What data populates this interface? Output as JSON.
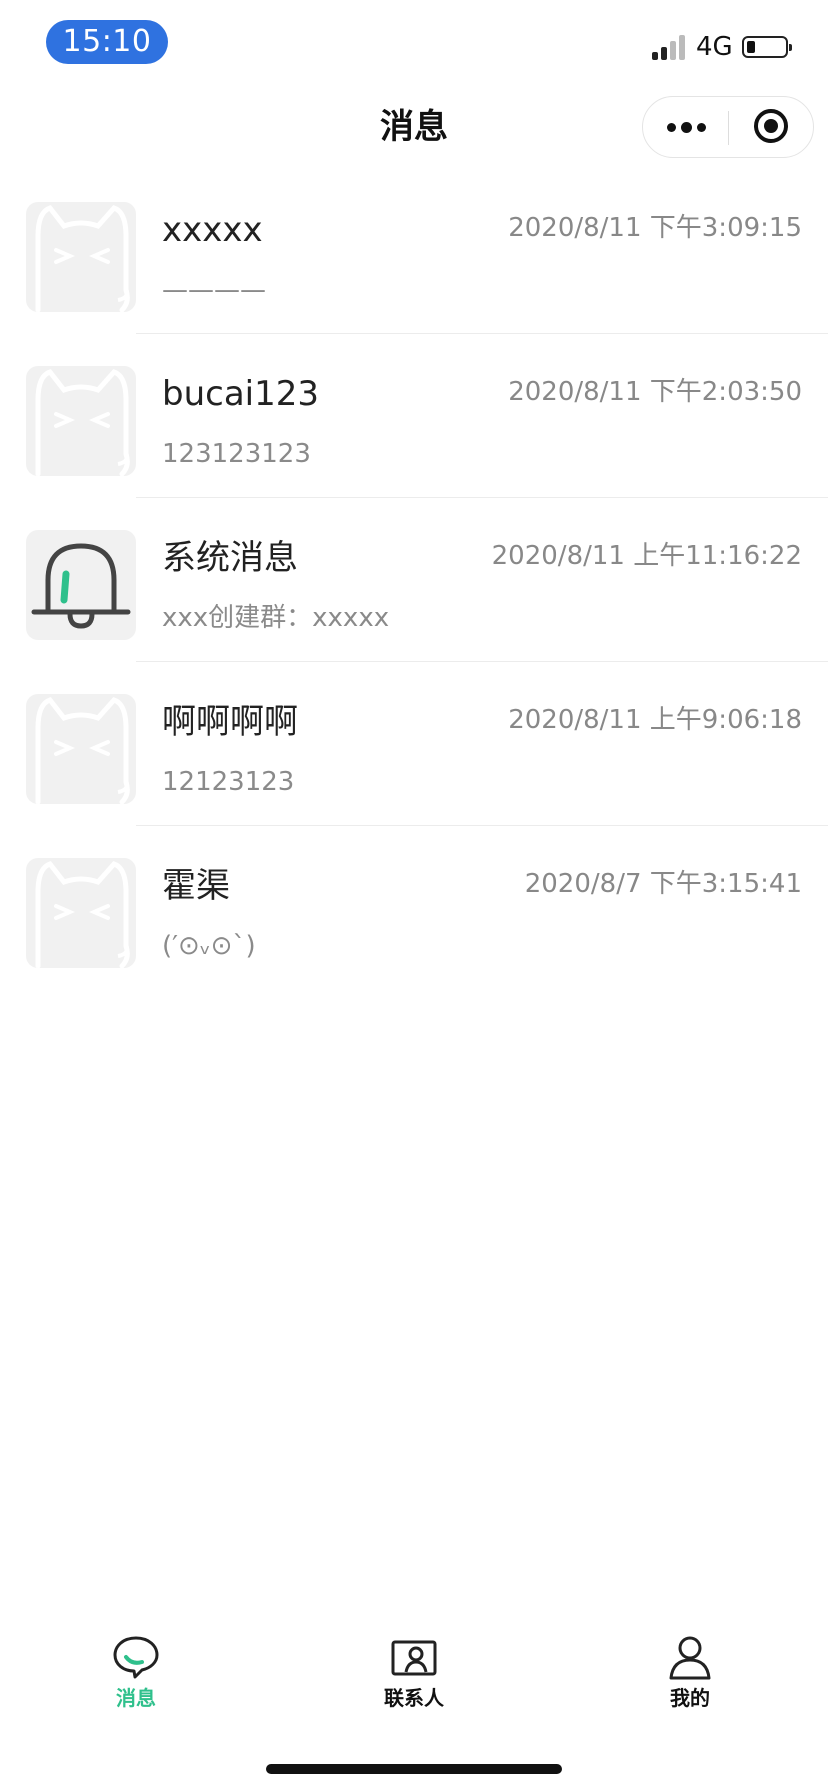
{
  "status_bar": {
    "time": "15:10",
    "network": "4G"
  },
  "nav": {
    "title": "消息"
  },
  "messages": [
    {
      "name": "xxxxx",
      "time": "2020/8/11 下午3:09:15",
      "preview": "————",
      "avatar": "cat-avatar-icon"
    },
    {
      "name": "bucai123",
      "time": "2020/8/11 下午2:03:50",
      "preview": "123123123",
      "avatar": "cat-avatar-icon"
    },
    {
      "name": "系统消息",
      "time": "2020/8/11 上午11:16:22",
      "preview": "xxx创建群：xxxxx",
      "avatar": "bell-icon"
    },
    {
      "name": "啊啊啊啊",
      "time": "2020/8/11 上午9:06:18",
      "preview": "12123123",
      "avatar": "cat-avatar-icon"
    },
    {
      "name": "霍渠",
      "time": "2020/8/7 下午3:15:41",
      "preview": "(′⊙ᵥ⊙`)",
      "avatar": "cat-avatar-icon"
    }
  ],
  "tabs": [
    {
      "label": "消息",
      "icon": "chat-bubble-icon",
      "active": true
    },
    {
      "label": "联系人",
      "icon": "contact-card-icon",
      "active": false
    },
    {
      "label": "我的",
      "icon": "person-icon",
      "active": false
    }
  ],
  "colors": {
    "accent": "#2fc08c",
    "time_pill": "#2f72e0"
  }
}
